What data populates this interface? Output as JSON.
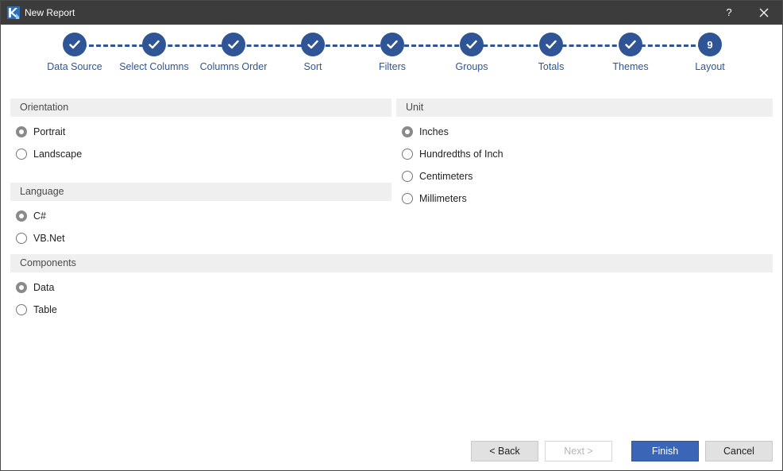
{
  "window": {
    "title": "New Report",
    "help_label": "?",
    "close_icon": "close-icon",
    "app_icon": "report-designer-logo-icon"
  },
  "wizard": {
    "steps": [
      {
        "label": "Data Source",
        "status": "done"
      },
      {
        "label": "Select Columns",
        "status": "done"
      },
      {
        "label": "Columns Order",
        "status": "done"
      },
      {
        "label": "Sort",
        "status": "done"
      },
      {
        "label": "Filters",
        "status": "done"
      },
      {
        "label": "Groups",
        "status": "done"
      },
      {
        "label": "Totals",
        "status": "done"
      },
      {
        "label": "Themes",
        "status": "done"
      },
      {
        "label": "Layout",
        "status": "current",
        "number": "9"
      }
    ],
    "accent_color": "#2f5597"
  },
  "orientation": {
    "header": "Orientation",
    "options": [
      {
        "label": "Portrait",
        "checked": true
      },
      {
        "label": "Landscape",
        "checked": false
      }
    ]
  },
  "unit": {
    "header": "Unit",
    "options": [
      {
        "label": "Inches",
        "checked": true
      },
      {
        "label": "Hundredths of Inch",
        "checked": false
      },
      {
        "label": "Centimeters",
        "checked": false
      },
      {
        "label": "Millimeters",
        "checked": false
      }
    ]
  },
  "language": {
    "header": "Language",
    "options": [
      {
        "label": "C#",
        "checked": true
      },
      {
        "label": "VB.Net",
        "checked": false
      }
    ]
  },
  "components": {
    "header": "Components",
    "options": [
      {
        "label": "Data",
        "checked": true
      },
      {
        "label": "Table",
        "checked": false
      }
    ]
  },
  "buttons": {
    "back": "< Back",
    "next": "Next >",
    "finish": "Finish",
    "cancel": "Cancel"
  }
}
